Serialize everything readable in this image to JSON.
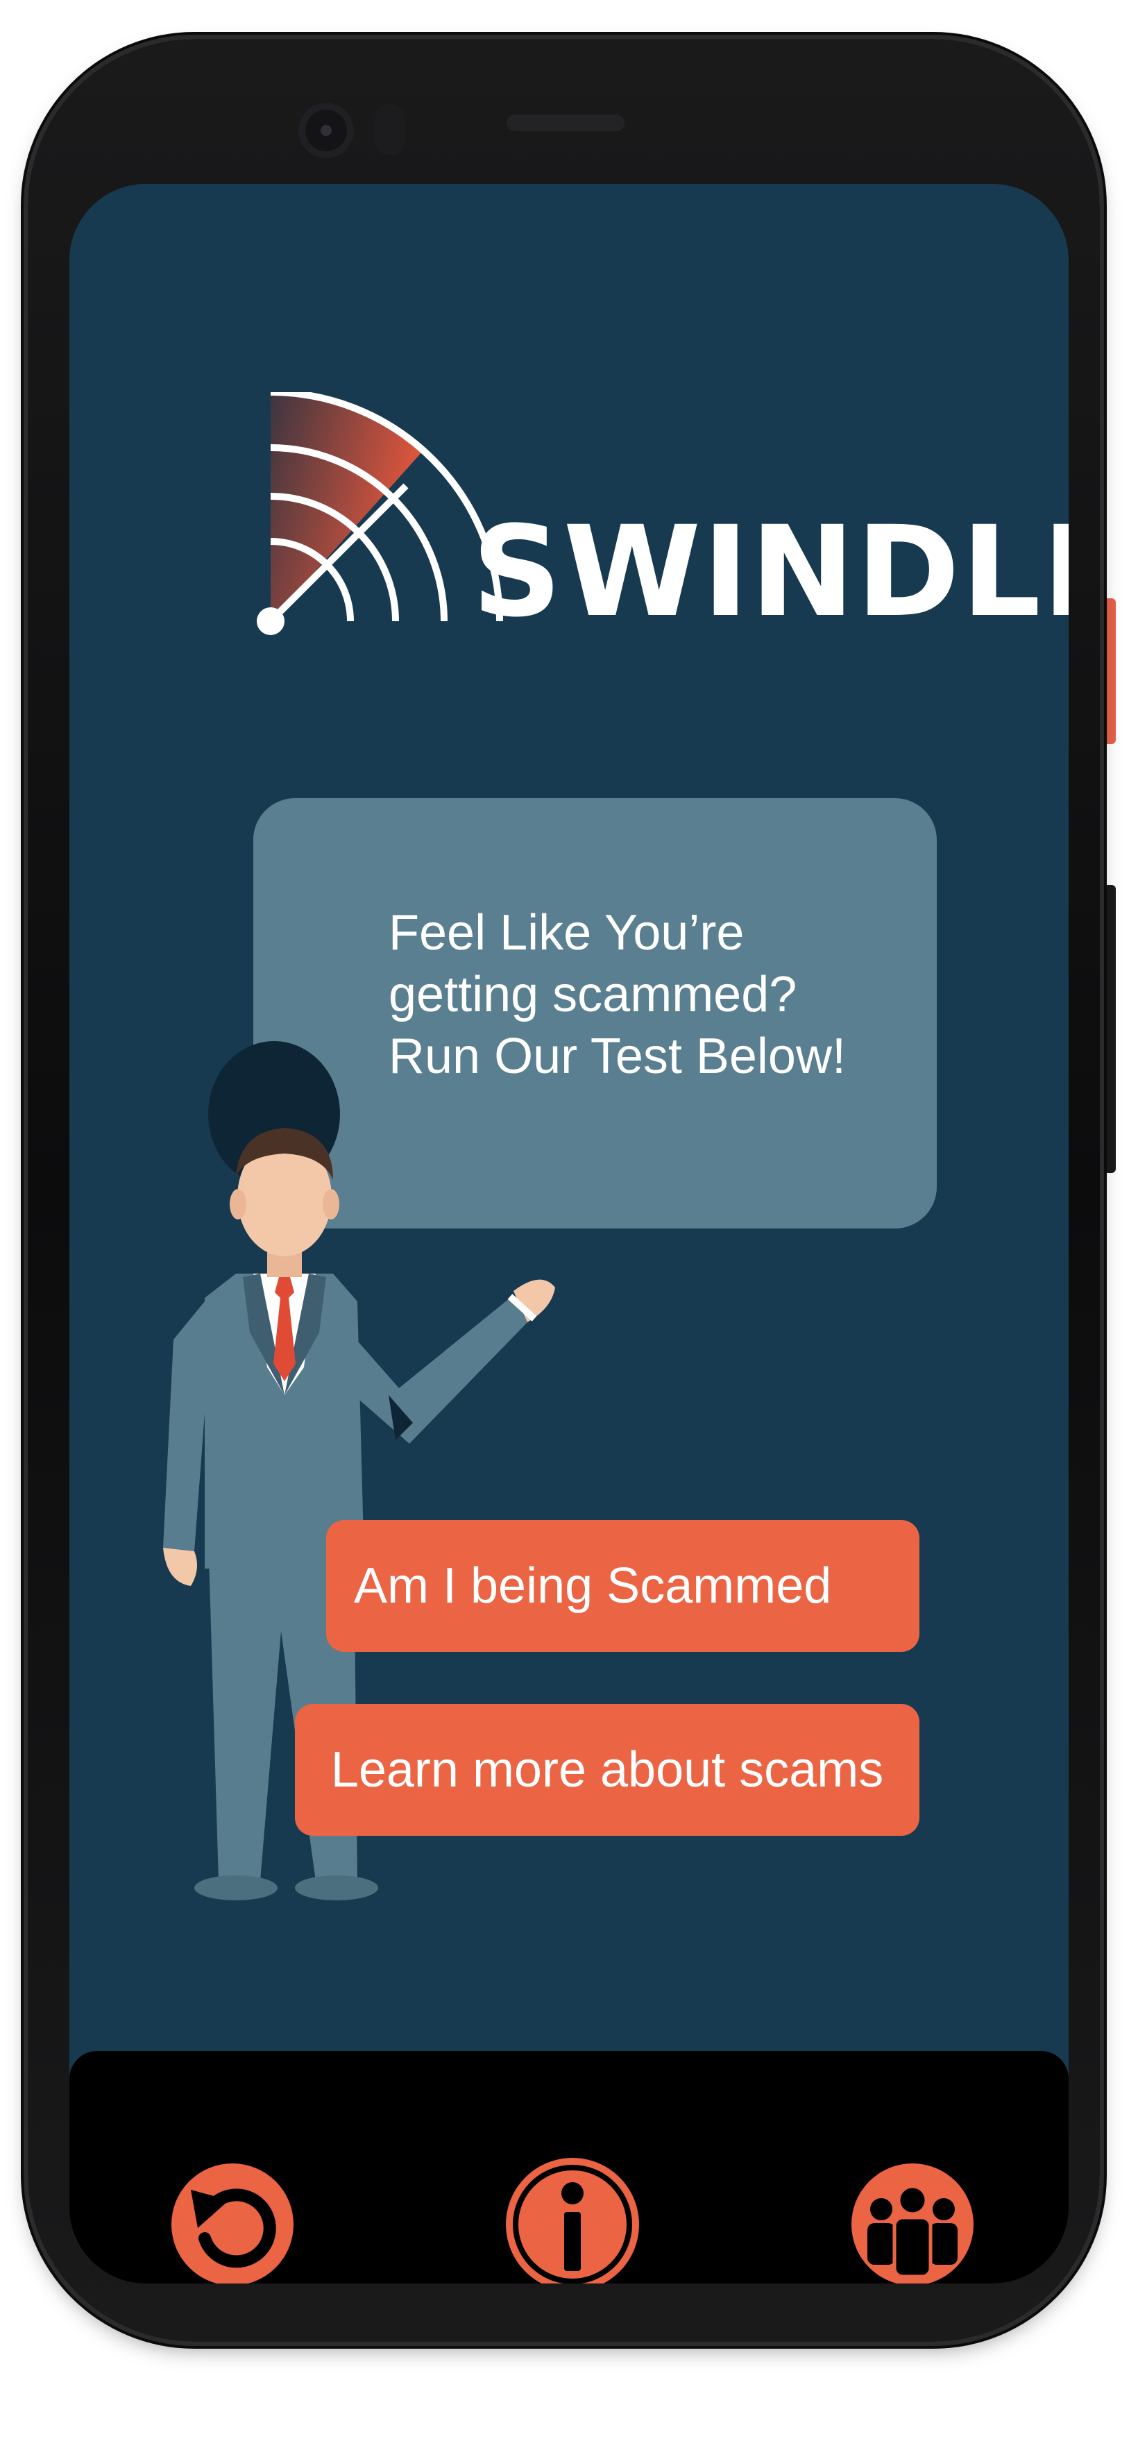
{
  "app": {
    "name": "SWINDLE"
  },
  "speech_bubble": {
    "line1": "Feel Like You’re",
    "line2": "getting scammed?",
    "line3": "Run Our Test Below!"
  },
  "buttons": {
    "scam_check_label": "Am I being Scammed",
    "learn_label": "Learn more about scams"
  },
  "bottom_nav": {
    "items": [
      {
        "icon": "back-icon"
      },
      {
        "icon": "info-icon"
      },
      {
        "icon": "people-icon"
      }
    ]
  },
  "colors": {
    "screen_background": "#173a50",
    "accent": "#eb6444",
    "bubble": "#5a7f90",
    "nav_bar": "#000000"
  }
}
